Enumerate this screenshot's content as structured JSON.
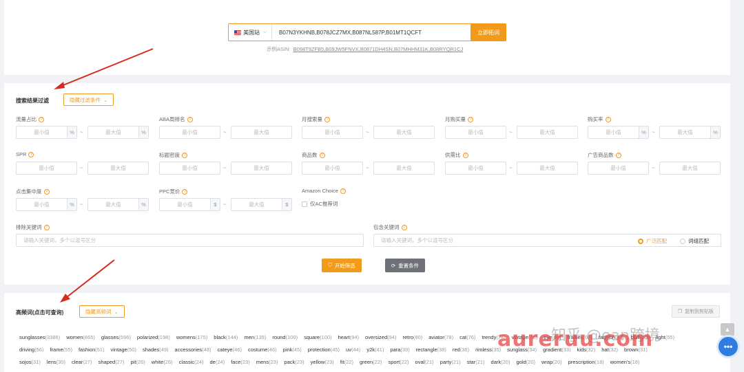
{
  "search": {
    "site": "美国站",
    "value": "B07N3YKHNB,B078JCZ7MX,B087NL587P,B01MT1QCFT",
    "button": "立即拓词",
    "example_label": "示例ASIN:",
    "example_codes": "B098T9ZFB5,B09JW5FNVX,B0871DH4SN,B07MHHM31K,B08RYQR1CJ"
  },
  "filter": {
    "title": "搜索结果过滤",
    "toggle": "隐藏过滤条件",
    "min_ph": "最小值",
    "max_ph": "最大值",
    "percent": "%",
    "dollar": "$",
    "tilde": "~",
    "labels": {
      "traffic": "流量占比",
      "aba": "ABA周排名",
      "monthly_search": "月搜索量",
      "monthly_purchase": "月购买量",
      "purchase_rate": "购买率",
      "spr": "SPR",
      "title_density": "标题密度",
      "product_count": "商品数",
      "supply_ratio": "供需比",
      "ad_products": "广告商品数",
      "click_conc": "点击集中度",
      "ppc": "PPC竞价",
      "amazon_choice": "Amazon Choice"
    },
    "ac_only": "仅AC推荐词",
    "exclude_label": "排除关键词",
    "include_label": "包含关键词",
    "kw_placeholder": "请输入关键词，多个以逗号区分",
    "match_broad": "广泛匹配",
    "match_phrase": "词组匹配",
    "start_btn": "开始筛选",
    "reset_btn": "重置条件"
  },
  "freq": {
    "title": "高频词(点击可查询)",
    "toggle": "隐藏高频词",
    "copy_btn": "复制到剪贴板",
    "rows": [
      [
        [
          "sunglasses",
          "3386"
        ],
        [
          "women",
          "865"
        ],
        [
          "glasses",
          "596"
        ],
        [
          "polarized",
          "198"
        ],
        [
          "womens",
          "175"
        ],
        [
          "black",
          "144"
        ],
        [
          "men",
          "135"
        ],
        [
          "round",
          "100"
        ],
        [
          "square",
          "100"
        ],
        [
          "heart",
          "94"
        ],
        [
          "oversized",
          "94"
        ],
        [
          "retro",
          "80"
        ],
        [
          "aviator",
          "78"
        ],
        [
          "cat",
          "76"
        ],
        [
          "trendy",
          "74"
        ],
        [
          "vintage",
          "70"
        ],
        [
          "eye",
          "68"
        ],
        [
          "frames",
          "66"
        ],
        [
          "fashion",
          "60"
        ],
        [
          "blue",
          "58"
        ],
        [
          "light",
          "55"
        ]
      ],
      [
        [
          "driving",
          "56"
        ],
        [
          "frame",
          "55"
        ],
        [
          "fashion",
          "51"
        ],
        [
          "vintage",
          "50"
        ],
        [
          "shades",
          "49"
        ],
        [
          "accessories",
          "48"
        ],
        [
          "cateye",
          "46"
        ],
        [
          "costume",
          "46"
        ],
        [
          "pink",
          "45"
        ],
        [
          "protection",
          "45"
        ],
        [
          "uv",
          "44"
        ],
        [
          "y2k",
          "41"
        ],
        [
          "para",
          "39"
        ],
        [
          "rectangle",
          "38"
        ],
        [
          "red",
          "36"
        ],
        [
          "rimless",
          "35"
        ],
        [
          "sunglass",
          "34"
        ],
        [
          "gradient",
          "33"
        ],
        [
          "kids",
          "32"
        ],
        [
          "hat",
          "32"
        ],
        [
          "brown",
          "31"
        ]
      ],
      [
        [
          "sojos",
          "31"
        ],
        [
          "lens",
          "30"
        ],
        [
          "clear",
          "27"
        ],
        [
          "shaped",
          "27"
        ],
        [
          "pit",
          "26"
        ],
        [
          "white",
          "26"
        ],
        [
          "classic",
          "24"
        ],
        [
          "de",
          "24"
        ],
        [
          "face",
          "23"
        ],
        [
          "mens",
          "23"
        ],
        [
          "pack",
          "23"
        ],
        [
          "yellow",
          "23"
        ],
        [
          "fit",
          "22"
        ],
        [
          "green",
          "22"
        ],
        [
          "sport",
          "22"
        ],
        [
          "oval",
          "21"
        ],
        [
          "party",
          "21"
        ],
        [
          "star",
          "21"
        ],
        [
          "dark",
          "20"
        ],
        [
          "gold",
          "20"
        ],
        [
          "wrap",
          "20"
        ],
        [
          "prescription",
          "18"
        ],
        [
          "women's",
          "18"
        ]
      ]
    ]
  },
  "watermark": "aureruu.com",
  "watermark2": "知乎 @ean跨境"
}
